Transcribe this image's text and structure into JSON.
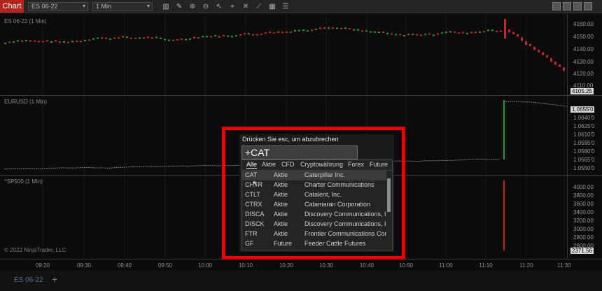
{
  "toolbar": {
    "chart_tab": "Chart",
    "instrument": "ES 06-22",
    "interval": "1 Min",
    "tools": [
      "bar-chart-icon",
      "pencil-icon",
      "zoom-in-icon",
      "zoom-out-icon",
      "pointer-icon",
      "crosshair-icon",
      "cross-icon",
      "drawing-icon",
      "strategy-icon",
      "properties-icon"
    ]
  },
  "panels": {
    "p1": "ES 06-22 (1 Min)",
    "p2": "EURUSD (1 Min)",
    "p3": "^SP500 (1 Min)"
  },
  "y_axis": {
    "p1": [
      "4160.00",
      "4150.00",
      "4140.00",
      "4130.00",
      "4120.00",
      "4110.00"
    ],
    "p1_current": "4105.25",
    "p2": [
      "1.0655'0",
      "1.0640'0",
      "1.0625'0",
      "1.0610'0",
      "1.0595'0",
      "1.0580'0",
      "1.0565'0",
      "1.0550'0"
    ],
    "p3": [
      "4000.00",
      "3800.00",
      "3600.00",
      "3400.00",
      "3200.00",
      "3000.00",
      "2800.00",
      "2600.00"
    ],
    "p3_current": "2371.56"
  },
  "x_axis": [
    "09:20",
    "09:30",
    "09:40",
    "09:50",
    "10:00",
    "10:10",
    "10:20",
    "10:30",
    "10:40",
    "10:50",
    "11:00",
    "11:10",
    "11:20",
    "11:30"
  ],
  "copyright": "© 2022 NinjaTrader, LLC",
  "bottom_tab": "ES 06-22",
  "search": {
    "hint": "Drücken Sie esc, um abzubrechen",
    "value": "+CAT",
    "filters": [
      "Alle",
      "Aktie",
      "CFD",
      "Cryptowährung",
      "Forex",
      "Future"
    ],
    "active_filter": "Alle",
    "results": [
      {
        "symbol": "CAT",
        "type": "Aktie",
        "name": "Caterpillar Inc."
      },
      {
        "symbol": "CHTR",
        "type": "Aktie",
        "name": "Charter Communications"
      },
      {
        "symbol": "CTLT",
        "type": "Aktie",
        "name": "Catalent, Inc."
      },
      {
        "symbol": "CTRX",
        "type": "Aktie",
        "name": "Catamaran Corporation"
      },
      {
        "symbol": "DISCA",
        "type": "Aktie",
        "name": "Discovery Communications, Inc."
      },
      {
        "symbol": "DISCK",
        "type": "Aktie",
        "name": "Discovery Communications, Inc."
      },
      {
        "symbol": "FTR",
        "type": "Aktie",
        "name": "Frontier Communications Corp"
      },
      {
        "symbol": "GF",
        "type": "Future",
        "name": "Feeder Cattle Futures"
      }
    ]
  },
  "colors": {
    "accent": "#b3241f",
    "highlight": "#ee0000",
    "up": "#1f9a3a",
    "down": "#c62828"
  }
}
